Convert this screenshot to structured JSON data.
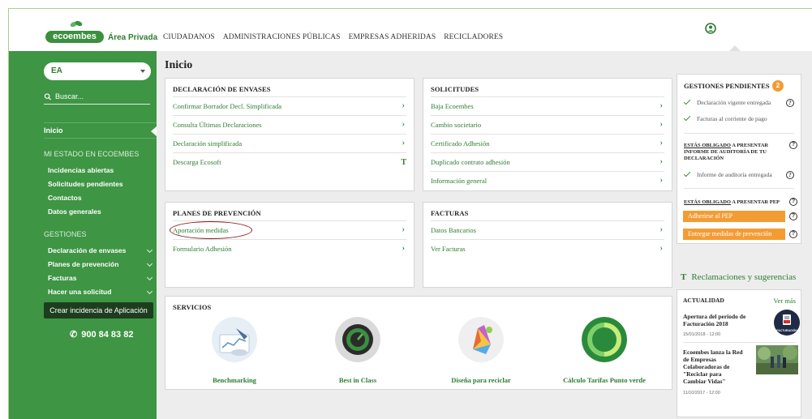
{
  "brand": {
    "logo_text": "ecoembes",
    "area_label": "Área Privada",
    "primary_color": "#3e9544",
    "accent_color": "#f39c34",
    "link_color": "#2e7d32"
  },
  "topnav": [
    "CIUDADANOS",
    "ADMINISTRACIONES PÚBLICAS",
    "EMPRESAS ADHERIDAS",
    "RECICLADORES"
  ],
  "sidebar": {
    "select_value": "EA",
    "search_placeholder": "Buscar...",
    "active_item": "Inicio",
    "section1_heading": "MI ESTADO EN ECOEMBES",
    "section1_items": [
      "Incidencias abiertas",
      "Solicitudes pendientes",
      "Contactos",
      "Datos generales"
    ],
    "section2_heading": "GESTIONES",
    "section2_items": [
      "Declaración de envases",
      "Planes de prevención",
      "Facturas",
      "Hacer una solicitud"
    ],
    "button_label": "Crear incidencia de Aplicación",
    "phone": "900 84 83 82"
  },
  "main": {
    "title": "Inicio",
    "declaracion": {
      "title": "DECLARACIÓN DE ENVASES",
      "items": [
        "Confirmar Borrador Decl. Simplificada",
        "Consulta Últimas Declaraciones",
        "Declaración simplificada",
        "Descarga Ecosoft"
      ]
    },
    "solicitudes": {
      "title": "SOLICITUDES",
      "items": [
        "Baja Ecoembes",
        "Cambio societario",
        "Certificado Adhesión",
        "Duplicado contrato adhesión",
        "Información general"
      ]
    },
    "planes": {
      "title": "PLANES DE PREVENCIÓN",
      "items": [
        "Aportación medidas",
        "Formulario Adhesión"
      ]
    },
    "facturas": {
      "title": "FACTURAS",
      "items": [
        "Datos Bancarios",
        "Ver Facturas"
      ]
    },
    "servicios": {
      "title": "SERVICIOS",
      "items": [
        "Benchmarking",
        "Best in Class",
        "Diseña para reciclar",
        "Cálculo Tarifas Punto verde"
      ]
    }
  },
  "right": {
    "gestiones_title": "GESTIONES PENDIENTES",
    "gestiones_count": "2",
    "check1": "Declaración vigente entregada",
    "check2": "Facturas al corriente de pago",
    "obligado1_link": "ESTÁS OBLIGADO",
    "obligado1_rest": " A PRESENTAR INFORME DE AUDITORÍA DE TU DECLARACIÓN",
    "check3": "Informe de auditoría entregada",
    "obligado2_link": "ESTÁS OBLIGADO",
    "obligado2_rest": " A PRESENTAR PEP",
    "btn1": "Adherirse al PEP",
    "btn2": "Entregar medidas de prevención",
    "reclamaciones": "Reclamaciones y sugerencias",
    "actualidad_title": "ACTUALIDAD",
    "ver_mas": "Ver más",
    "news1_title": "Apertura del periodo de Facturación 2018",
    "news1_date": "15/01/2018 - 12:00",
    "news1_thumb_label": "FACTURACIÓN",
    "news2_title": "Ecoembes lanza la Red de Empresas Colaboradoras de \"Reciclar para Cambiar Vidas\"",
    "news2_date": "11/10/2017 - 12:00"
  }
}
